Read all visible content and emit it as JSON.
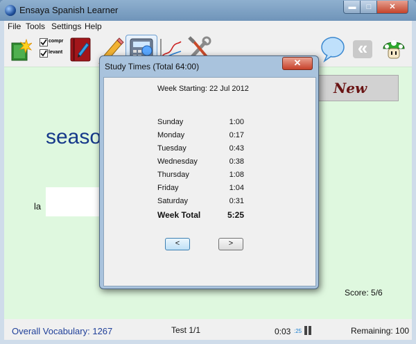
{
  "window": {
    "title": "Ensaya Spanish Learner",
    "min_glyph": "▬",
    "max_glyph": "□",
    "close_glyph": "✕"
  },
  "menu": [
    "File",
    "Tools",
    "Settings",
    "Help"
  ],
  "toolbar": {
    "check1_label": "compr",
    "check2_label": "levant",
    "back_glyph": "«"
  },
  "content": {
    "word": "seaso",
    "article": "la",
    "new_button": "New",
    "score": "Score: 5/6"
  },
  "status": {
    "vocab": "Overall Vocabulary: 1267",
    "test": "Test 1/1",
    "time": "0:03",
    "time_small": ":25",
    "remaining": "Remaining: 100"
  },
  "dialog": {
    "title": "Study Times  (Total 64:00)",
    "close_glyph": "✕",
    "week_starting": "Week Starting: 22 Jul 2012",
    "days": [
      {
        "day": "Sunday",
        "time": "1:00"
      },
      {
        "day": "Monday",
        "time": "0:17"
      },
      {
        "day": "Tuesday",
        "time": "0:43"
      },
      {
        "day": "Wednesday",
        "time": "0:38"
      },
      {
        "day": "Thursday",
        "time": "1:08"
      },
      {
        "day": "Friday",
        "time": "1:04"
      },
      {
        "day": "Saturday",
        "time": "0:31"
      }
    ],
    "total_label": "Week Total",
    "total_value": "5:25",
    "prev_label": "<",
    "next_label": ">"
  }
}
